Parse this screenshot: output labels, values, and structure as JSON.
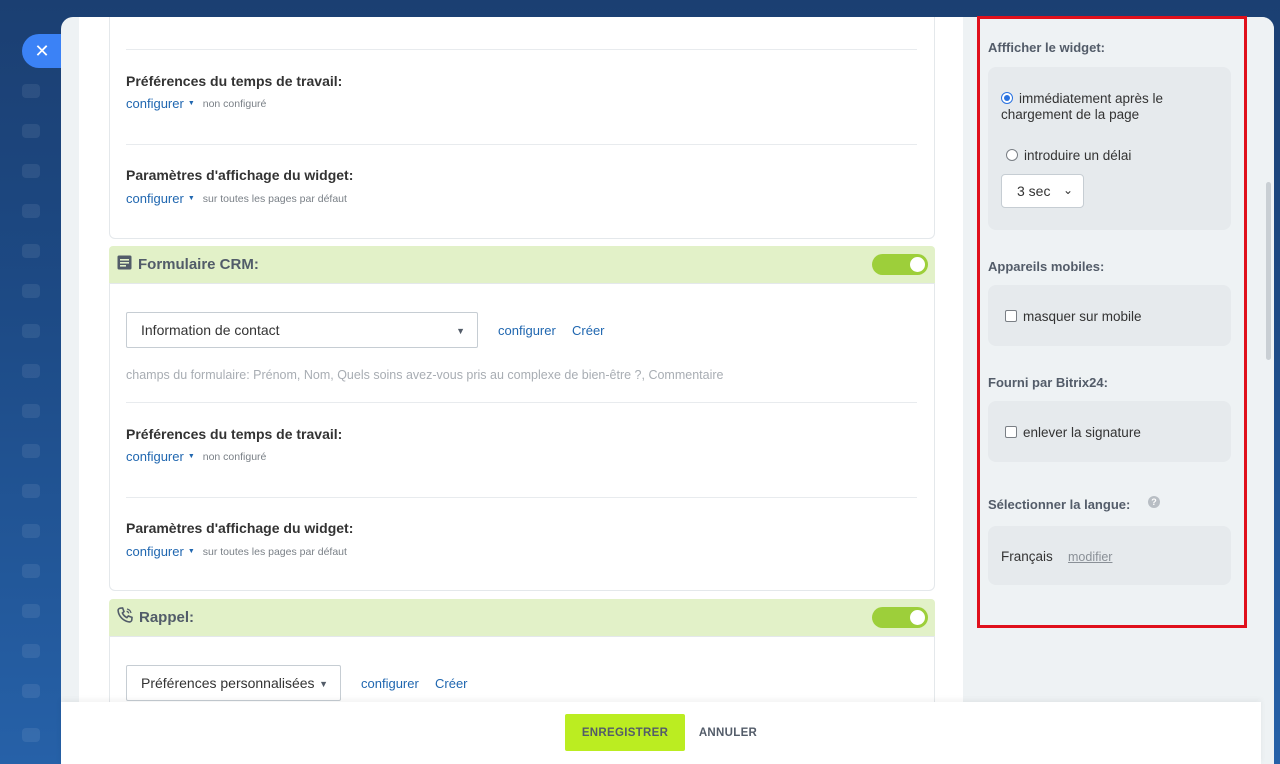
{
  "close_icon": "close-icon",
  "top_card": {
    "work_time": {
      "title": "Préférences du temps de travail:",
      "link": "configurer",
      "note": "non configuré"
    },
    "display": {
      "title": "Paramètres d'affichage du widget:",
      "link": "configurer",
      "note": "sur toutes les pages par défaut"
    }
  },
  "crm_form": {
    "title": "Formulaire CRM:",
    "icon": "form-icon",
    "enabled": true,
    "select_value": "Information de contact",
    "configure": "configurer",
    "create": "Créer",
    "fields_hint": "champs du formulaire: Prénom, Nom, Quels soins avez-vous pris au complexe de bien-être ?, Commentaire",
    "work_time": {
      "title": "Préférences du temps de travail:",
      "link": "configurer",
      "note": "non configuré"
    },
    "display": {
      "title": "Paramètres d'affichage du widget:",
      "link": "configurer",
      "note": "sur toutes les pages par défaut"
    }
  },
  "callback": {
    "title": "Rappel:",
    "icon": "phone-icon",
    "enabled": true,
    "select_value": "Préférences personnalisées",
    "configure": "configurer",
    "create": "Créer"
  },
  "right_panel": {
    "show_widget": {
      "title": "Affficher le widget:",
      "option_immediate": "immédiatement après le chargement de la page",
      "option_delay": "introduire un délai",
      "delay_value": "3 sec",
      "selected": "immediate"
    },
    "mobile": {
      "title": "Appareils mobiles:",
      "hide_on_mobile": "masquer sur mobile",
      "checked": false
    },
    "powered": {
      "title": "Fourni par Bitrix24:",
      "remove_signature": "enlever la signature",
      "checked": false
    },
    "language": {
      "title": "Sélectionner la langue:",
      "value": "Français",
      "modify": "modifier",
      "help_icon": "?"
    }
  },
  "footer": {
    "save": "ENREGISTRER",
    "cancel": "ANNULER"
  },
  "colors": {
    "accent_green": "#bbed21",
    "toggle_green": "#9dcf3a",
    "header_green": "#e2f1c8",
    "link_blue": "#2067b0",
    "highlight_red": "#e0101c"
  }
}
